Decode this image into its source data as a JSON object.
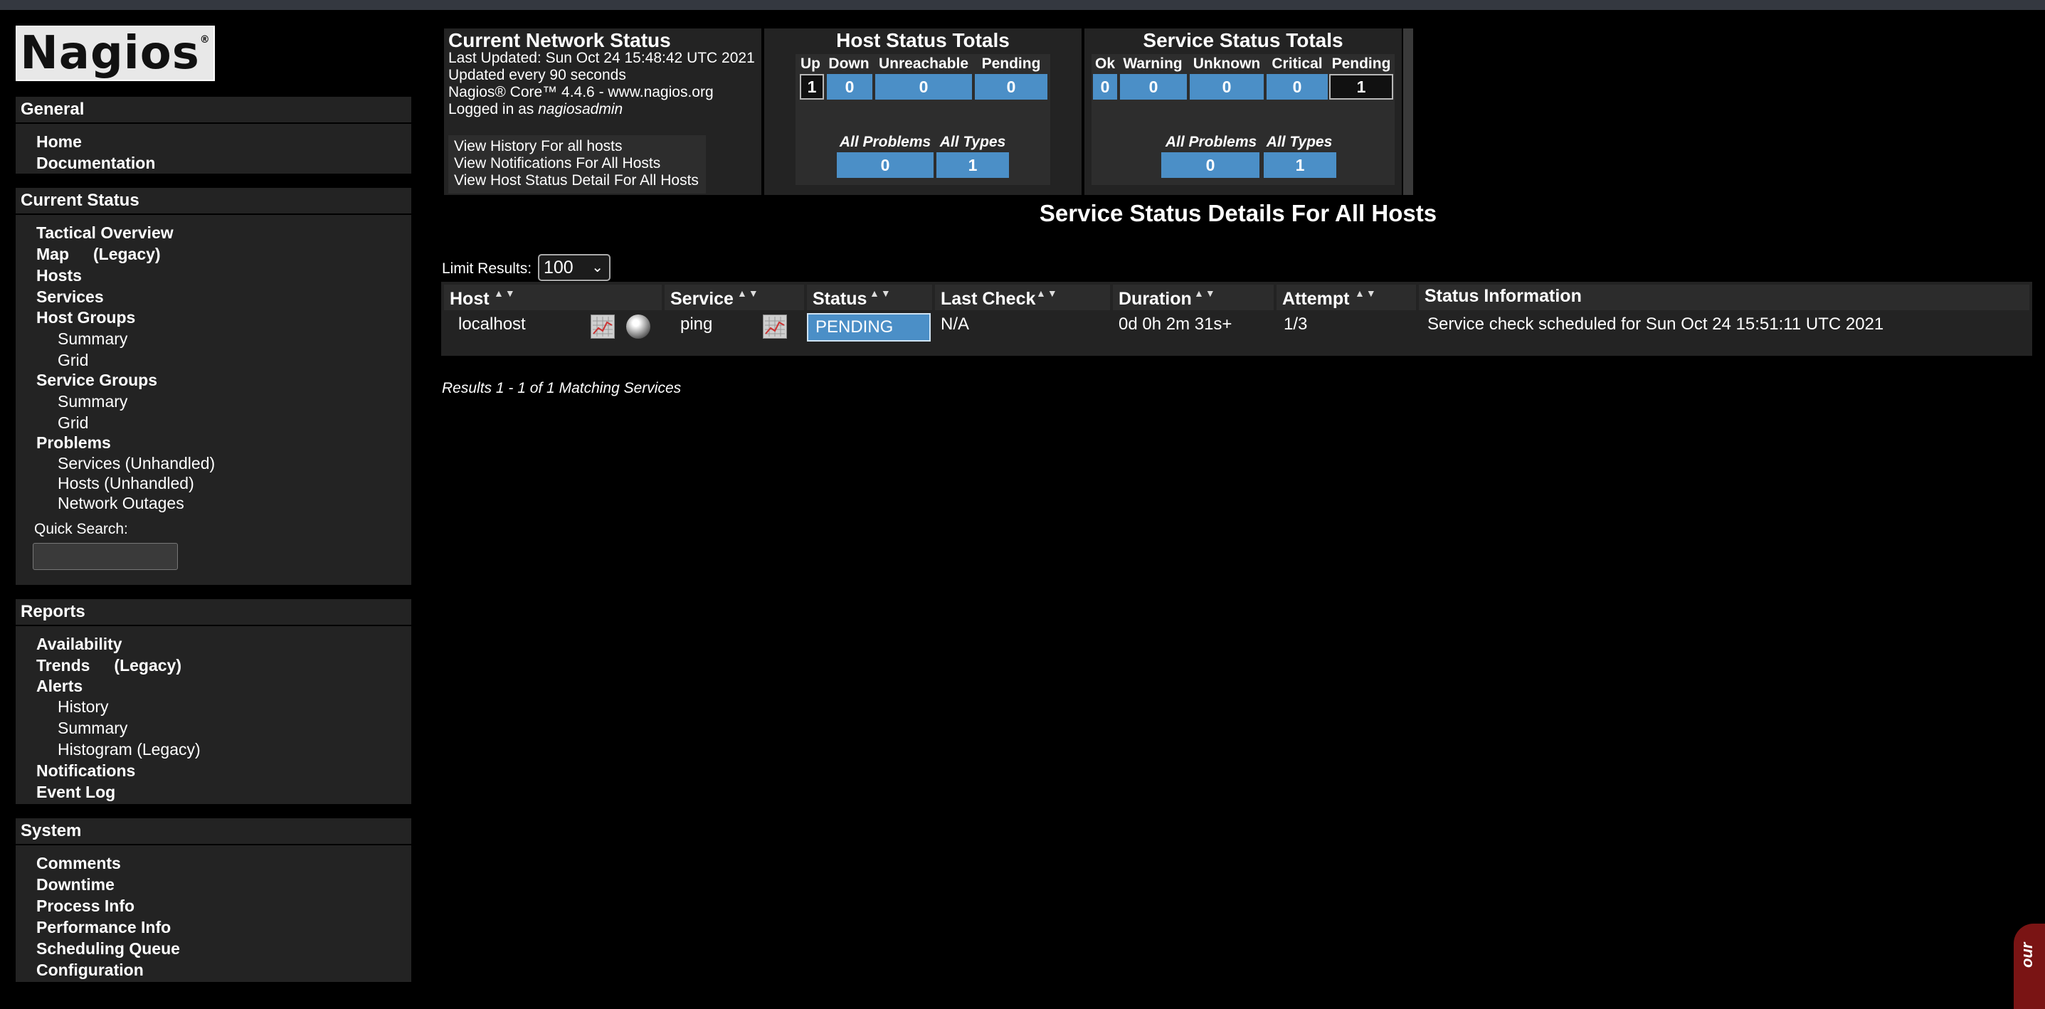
{
  "logo": {
    "text": "Nagios",
    "mark": "®"
  },
  "sidebar": {
    "general": {
      "title": "General",
      "items": [
        "Home",
        "Documentation"
      ]
    },
    "current_status": {
      "title": "Current Status",
      "tactical_overview": "Tactical Overview",
      "map": "Map",
      "map_legacy": "(Legacy)",
      "hosts": "Hosts",
      "services": "Services",
      "host_groups": "Host Groups",
      "host_groups_summary": "Summary",
      "host_groups_grid": "Grid",
      "service_groups": "Service Groups",
      "service_groups_summary": "Summary",
      "service_groups_grid": "Grid",
      "problems": "Problems",
      "services_unhandled": "Services (Unhandled)",
      "hosts_unhandled": "Hosts (Unhandled)",
      "network_outages": "Network Outages",
      "quick_search_label": "Quick Search:",
      "quick_search_value": ""
    },
    "reports": {
      "title": "Reports",
      "availability": "Availability",
      "trends": "Trends",
      "trends_legacy": "(Legacy)",
      "alerts": "Alerts",
      "alerts_history": "History",
      "alerts_summary": "Summary",
      "alerts_histogram": "Histogram (Legacy)",
      "notifications": "Notifications",
      "event_log": "Event Log"
    },
    "system": {
      "title": "System",
      "items": [
        "Comments",
        "Downtime",
        "Process Info",
        "Performance Info",
        "Scheduling Queue",
        "Configuration"
      ]
    }
  },
  "network_status": {
    "title": "Current Network Status",
    "last_updated": "Last Updated: Sun Oct 24 15:48:42 UTC 2021",
    "update_interval": "Updated every 90 seconds",
    "version": "Nagios® Core™ 4.4.6 - www.nagios.org",
    "logged_in_prefix": "Logged in as ",
    "user": "nagiosadmin",
    "links": [
      "View History For all hosts",
      "View Notifications For All Hosts",
      "View Host Status Detail For All Hosts"
    ]
  },
  "host_totals": {
    "title": "Host Status Totals",
    "labels": [
      "Up",
      "Down",
      "Unreachable",
      "Pending"
    ],
    "values": [
      "1",
      "0",
      "0",
      "0"
    ],
    "summary_labels": [
      "All Problems",
      "All Types"
    ],
    "summary_values": [
      "0",
      "1"
    ]
  },
  "service_totals": {
    "title": "Service Status Totals",
    "labels": [
      "Ok",
      "Warning",
      "Unknown",
      "Critical",
      "Pending"
    ],
    "values": [
      "0",
      "0",
      "0",
      "0",
      "1"
    ],
    "summary_labels": [
      "All Problems",
      "All Types"
    ],
    "summary_values": [
      "0",
      "1"
    ]
  },
  "main": {
    "title": "Service Status Details For All Hosts",
    "limit_label": "Limit Results:",
    "limit_value": "100",
    "columns": [
      "Host",
      "Service",
      "Status",
      "Last Check",
      "Duration",
      "Attempt",
      "Status Information"
    ],
    "row": {
      "host": "localhost",
      "service": "ping",
      "status": "PENDING",
      "last_check": "N/A",
      "duration": "0d 0h 2m 31s+",
      "attempt": "1/3",
      "info": "Service check scheduled for Sun Oct 24 15:51:11 UTC 2021"
    },
    "results": "Results 1 - 1 of 1 Matching Services"
  },
  "corner": {
    "text": "our"
  },
  "colors": {
    "status_blue": "#4b8fc7",
    "panel_bg": "#232323",
    "page_bg": "#000000"
  }
}
